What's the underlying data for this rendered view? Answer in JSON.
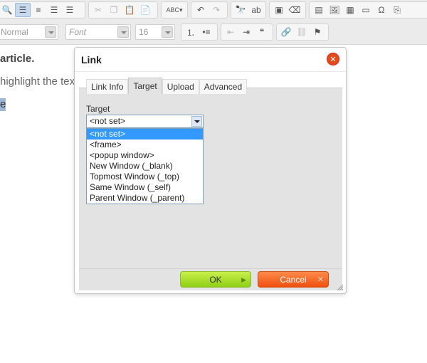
{
  "toolbar": {
    "format_combo": "Normal",
    "font_combo": "Font",
    "size_combo": "16"
  },
  "editor": {
    "line1": "article.",
    "line2": "highlight the tex",
    "line3": "e"
  },
  "dialog": {
    "title": "Link",
    "close_glyph": "✕",
    "tabs": [
      {
        "label": "Link Info"
      },
      {
        "label": "Target"
      },
      {
        "label": "Upload"
      },
      {
        "label": "Advanced"
      }
    ],
    "active_tab": "Target",
    "target_label": "Target",
    "target_selected": "<not set>",
    "target_options": [
      "<not set>",
      "<frame>",
      "<popup window>",
      "New Window (_blank)",
      "Topmost Window (_top)",
      "Same Window (_self)",
      "Parent Window (_parent)"
    ],
    "highlighted_option_index": 0,
    "ok_label": "OK",
    "cancel_label": "Cancel"
  },
  "colors": {
    "ok_button": "#a6dc2a",
    "cancel_button": "#f46220",
    "close_button": "#e64a19",
    "highlight": "#3399ff"
  }
}
